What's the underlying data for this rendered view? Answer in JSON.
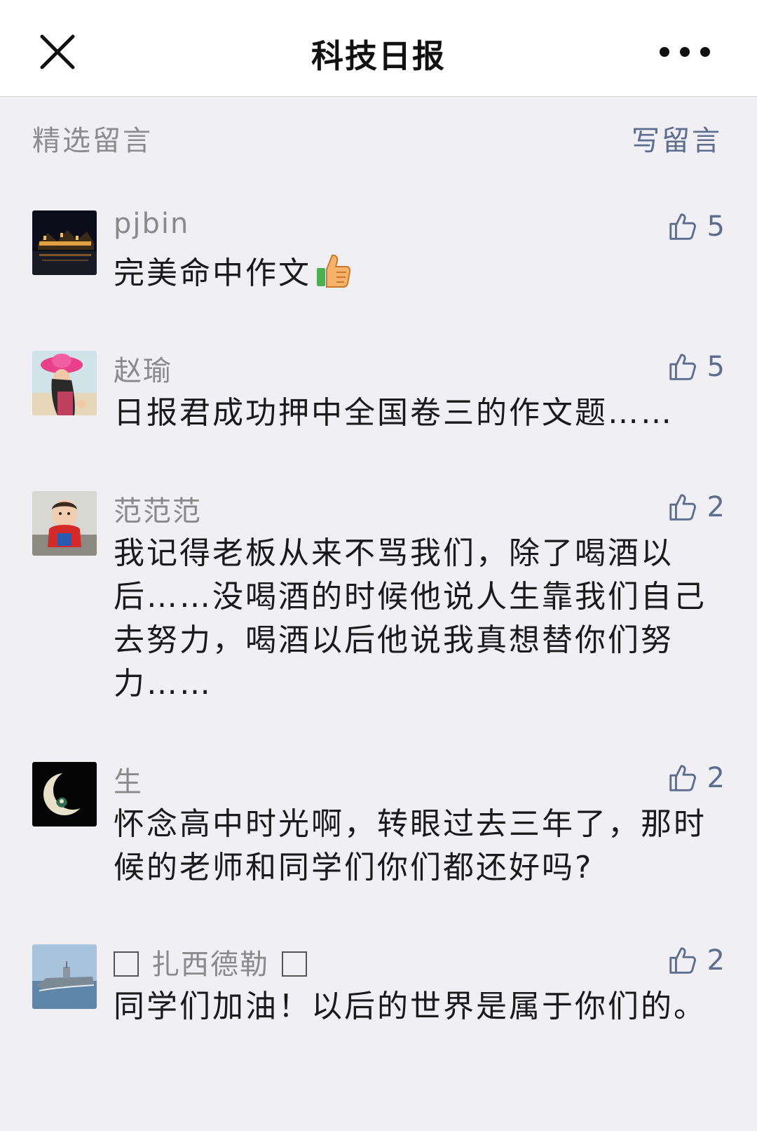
{
  "navbar": {
    "title": "科技日报"
  },
  "section": {
    "title": "精选留言",
    "write_label": "写留言"
  },
  "comments": [
    {
      "nickname": "pjbin",
      "content": "完美命中作文",
      "likes": "5"
    },
    {
      "nickname": "赵瑜",
      "content": "日报君成功押中全国卷三的作文题……",
      "likes": "5"
    },
    {
      "nickname": "范范范",
      "content": "我记得老板从来不骂我们，除了喝酒以后……没喝酒的时候他说人生靠我们自己去努力，喝酒以后他说我真想替你们努力……",
      "likes": "2"
    },
    {
      "nickname": "生",
      "content": "怀念高中时光啊，转眼过去三年了，那时候的老师和同学们你们都还好吗?",
      "likes": "2"
    },
    {
      "nickname": "扎西德勒",
      "content": "同学们加油！以后的世界是属于你们的。",
      "likes": "2"
    }
  ],
  "colors": {
    "background": "#efeff4",
    "link": "#5d6d8e",
    "muted": "#8c8c8c"
  },
  "icons": {
    "close": "close-icon",
    "more": "more-dots-icon",
    "like": "thumbs-up-icon",
    "emoji": "thumbs-up-emoji"
  }
}
